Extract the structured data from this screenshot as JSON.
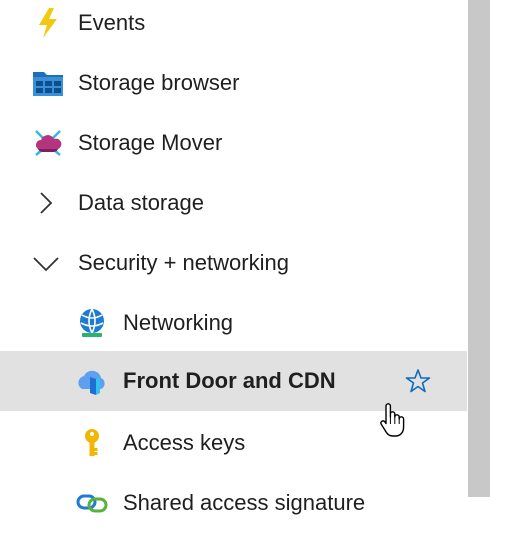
{
  "menu": {
    "items": [
      {
        "label": "Events",
        "icon": "lightning-icon"
      },
      {
        "label": "Storage browser",
        "icon": "storage-browser-icon"
      },
      {
        "label": "Storage Mover",
        "icon": "storage-mover-icon"
      },
      {
        "label": "Data storage",
        "icon": "chevron-right-icon"
      },
      {
        "label": "Security + networking",
        "icon": "chevron-down-icon"
      },
      {
        "label": "Networking",
        "icon": "networking-icon"
      },
      {
        "label": "Front Door and CDN",
        "icon": "front-door-cdn-icon",
        "selected": true,
        "favorite_icon": "star-icon"
      },
      {
        "label": "Access keys",
        "icon": "key-icon"
      },
      {
        "label": "Shared access signature",
        "icon": "shared-access-signature-icon"
      }
    ]
  },
  "colors": {
    "selected_background": "#e1e1e1",
    "star_outline": "#0f6cbd",
    "scrollbar_thumb": "#c8c8c8"
  }
}
